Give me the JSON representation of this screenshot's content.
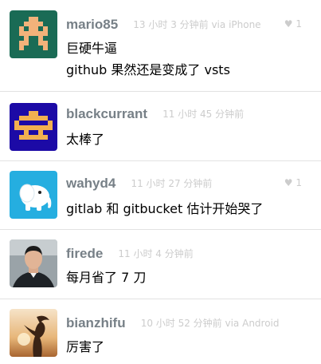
{
  "replies": [
    {
      "username": "mario85",
      "time": "13 小时 3 分钟前 via iPhone",
      "likes": "♥ 1",
      "lines": [
        "巨硬牛逼",
        "github 果然还是变成了 vsts"
      ],
      "avatar": "mario-pixel-avatar"
    },
    {
      "username": "blackcurrant",
      "time": "11 小时 45 分钟前",
      "likes": "",
      "lines": [
        "太棒了"
      ],
      "avatar": "pixel-glyph-avatar"
    },
    {
      "username": "wahyd4",
      "time": "11 小时 27 分钟前",
      "likes": "♥ 1",
      "lines": [
        "gitlab 和 gitbucket 估计开始哭了"
      ],
      "avatar": "elephant-avatar"
    },
    {
      "username": "firede",
      "time": "11 小时 4 分钟前",
      "likes": "",
      "lines": [
        "每月省了 7 刀"
      ],
      "avatar": "person-photo-avatar"
    },
    {
      "username": "bianzhifu",
      "time": "10 小时 52 分钟前 via Android",
      "likes": "",
      "lines": [
        "厉害了"
      ],
      "avatar": "silhouette-photo-avatar"
    }
  ],
  "colors": {
    "username": "#778087",
    "meta": "#cccccc",
    "divider": "#e2e2e2",
    "avatar_mario_bg": "#1a6b55",
    "avatar_mario_fg": "#f2b27a",
    "avatar_glyph_bg": "#1c0aa6",
    "avatar_glyph_fg": "#f2b050",
    "avatar_elephant_bg": "#25aee0"
  }
}
